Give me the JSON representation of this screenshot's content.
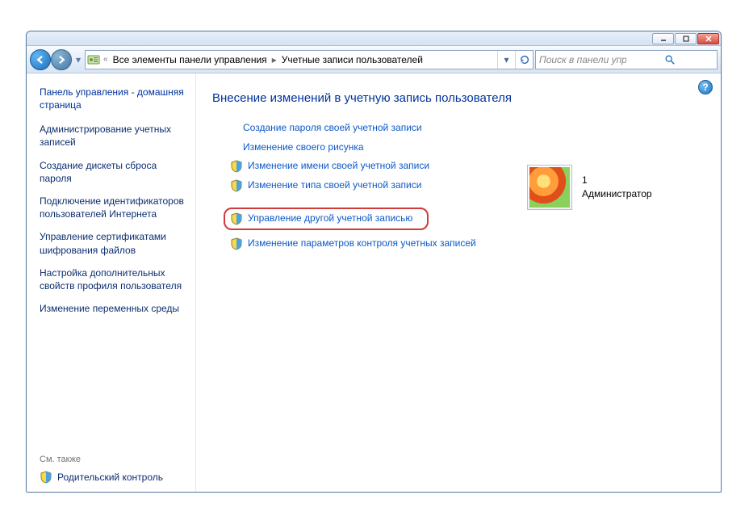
{
  "breadcrumb": {
    "prefix": "«",
    "part1": "Все элементы панели управления",
    "part2": "Учетные записи пользователей"
  },
  "search": {
    "placeholder": "Поиск в панели управления"
  },
  "sidebar": {
    "home": "Панель управления - домашняя страница",
    "links": [
      "Администрирование учетных записей",
      "Создание дискеты сброса пароля",
      "Подключение идентификаторов пользователей Интернета",
      "Управление сертификатами шифрования файлов",
      "Настройка дополнительных свойств профиля пользователя",
      "Изменение переменных среды"
    ],
    "see_also": "См. также",
    "parental": "Родительский контроль"
  },
  "main": {
    "heading": "Внесение изменений в учетную запись пользователя",
    "tasks": {
      "create_password": "Создание пароля своей учетной записи",
      "change_picture": "Изменение своего рисунка",
      "change_name": "Изменение имени своей учетной записи",
      "change_type": "Изменение типа своей учетной записи",
      "manage_other": "Управление другой учетной записью",
      "change_uac": "Изменение параметров контроля учетных записей"
    }
  },
  "user": {
    "name": "1",
    "role": "Администратор"
  }
}
